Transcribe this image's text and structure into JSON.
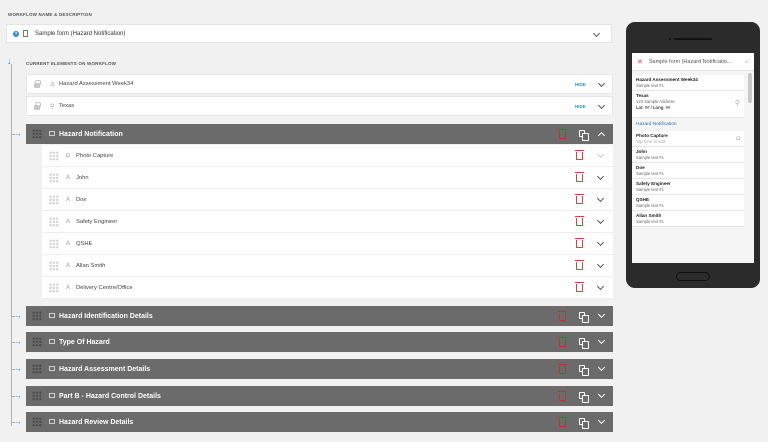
{
  "workflow": {
    "section_label": "WORKFLOW NAME & DESCRIPTION",
    "name": "Sample form (Hazard Notification)"
  },
  "current": {
    "section_label": "CURRENT ELEMENTS ON WORKFLOW",
    "hide_label": "HIDE",
    "static_rows": [
      {
        "label": "Hazard Assessment Week34",
        "icon": "person-icon"
      },
      {
        "label": "Texas",
        "icon": "location-pin-icon"
      }
    ]
  },
  "groups": [
    {
      "title": "Hazard Notification",
      "expanded": true
    },
    {
      "title": "Hazard Identification Details"
    },
    {
      "title": "Type Of Hazard"
    },
    {
      "title": "Hazard Assessment Details"
    },
    {
      "title": "Part B - Hazard Control Details"
    },
    {
      "title": "Hazard Review Details"
    }
  ],
  "fields": [
    {
      "label": "Photo Capture",
      "icon": "camera-icon"
    },
    {
      "label": "John",
      "icon": "text-a-icon"
    },
    {
      "label": "Doe",
      "icon": "text-a-icon"
    },
    {
      "label": "Safety Engineer",
      "icon": "text-a-icon"
    },
    {
      "label": "QSHE",
      "icon": "text-a-icon"
    },
    {
      "label": "Allan Smith",
      "icon": "text-a-icon"
    },
    {
      "label": "Delivery Centre/Office",
      "icon": "text-a-icon"
    }
  ],
  "preview": {
    "title": "Sample form (Hazard Notificatio...",
    "items": [
      {
        "t": "Hazard Assessment Week34",
        "s": "Sample text #1"
      },
      {
        "t": "Texas",
        "s": "123 Sample Address",
        "s2": "Lat: ##  /  Long: ##"
      }
    ],
    "section": "Hazard Notification",
    "items2": [
      {
        "t": "Photo Capture",
        "s": "Tap here to add"
      },
      {
        "t": "John",
        "s": "Sample text #1"
      },
      {
        "t": "Doe",
        "s": "Sample text #1"
      },
      {
        "t": "Safety Engineer",
        "s": "Sample text #1"
      },
      {
        "t": "QSHE",
        "s": "Sample text #1"
      },
      {
        "t": "Allan Smith",
        "s": "Sample text #1"
      }
    ]
  },
  "colors": {
    "accent": "#2a8fd0",
    "group_bg": "#6b6b6b",
    "delete": "#e0393e"
  }
}
